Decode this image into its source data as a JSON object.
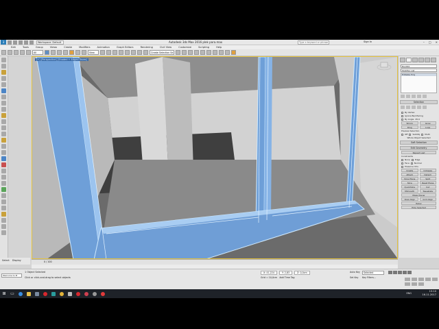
{
  "titlebar": {
    "workspace": "Workspace: Default",
    "title": "Autodesk 3ds Max 2016     plek para.max",
    "search_placeholder": "Type a keyword or phrase",
    "signin": "Sign In"
  },
  "menu": [
    "Edit",
    "Tools",
    "Group",
    "Views",
    "Create",
    "Modifiers",
    "Animation",
    "Graph Editors",
    "Rendering",
    "Civil View",
    "Customize",
    "Scripting",
    "Help"
  ],
  "toolbar": {
    "filter": "All",
    "refcoord": "View",
    "selset": "Create Selection Se"
  },
  "viewport": {
    "label": "[+] [Perspective] [Shaded + Edged Faces]"
  },
  "command_panel": {
    "object_name": "Box002",
    "modifier_list": "Modifier List",
    "stack_item": "Editable Poly",
    "selection_title": "Selection",
    "options": [
      "By Vertex",
      "Ignore Backfacing",
      "By Angle"
    ],
    "angle_value": "45.0",
    "shrink": "Shrink",
    "grow": "Grow",
    "ring": "Ring",
    "loop": "Loop",
    "preview_label": "Preview Selection",
    "preview_opts": [
      "Off",
      "SubObj",
      "Multi"
    ],
    "whole_status": "Whole Object Selected",
    "soft_selection": "Soft Selection",
    "edit_geometry": "Edit Geometry",
    "repeat_last": "Repeat Last",
    "constraints": "Constraints",
    "constraint_opts": [
      "None",
      "Edge",
      "Face",
      "Normal"
    ],
    "preserve_uvs": "Preserve UVs",
    "create": "Create",
    "collapse": "Collapse",
    "attach": "Attach",
    "detach": "Detach",
    "slice_plane": "Slice Plane",
    "split": "Split",
    "slice": "Slice",
    "reset_plane": "Reset Plane",
    "quickslice": "QuickSlice",
    "cut": "Cut",
    "msmooth": "MSmooth",
    "tessellate": "Tessellate",
    "make_planar": "Make Planar",
    "view_align": "View Align",
    "grid_align": "Grid Align",
    "relax": "Relax",
    "hide_selected": "Hide Selected"
  },
  "timeslider": {
    "label": "0 / 100"
  },
  "status": {
    "maxscript": "Welcome to M",
    "line1": "1 Object Selected",
    "line2": "Click or click-and-drag to select objects",
    "x": "X: 41,224",
    "y": "Y: 2,83",
    "z": "Z: 0,0cm",
    "grid": "Grid = 10,0cm",
    "add_time_tag": "Add Time Tag",
    "auto_key": "Auto Key",
    "set_key": "Set Key",
    "key_filters": "Key Filters...",
    "selected": "Selected"
  },
  "taskbar": {
    "time": "15:10",
    "date": "16.11.2017",
    "lang": "ENG"
  }
}
